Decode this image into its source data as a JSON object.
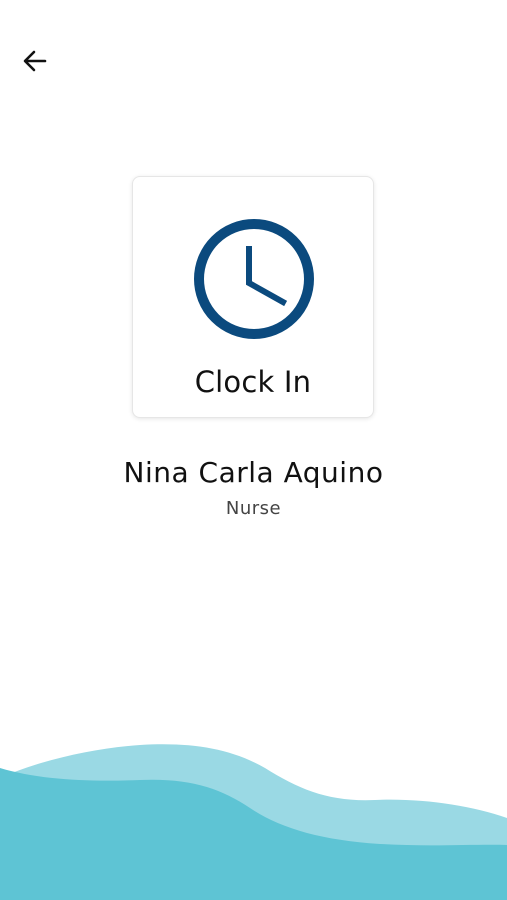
{
  "back_button": {
    "icon": "arrow-left-icon"
  },
  "clock_card": {
    "icon": "clock-icon",
    "label": "Clock In",
    "icon_color": "#0b4a7e"
  },
  "employee": {
    "name": "Nina Carla Aquino",
    "role": "Nurse"
  },
  "theme": {
    "wave_light": "#9ad9e4",
    "wave_dark": "#5ec4d4"
  }
}
